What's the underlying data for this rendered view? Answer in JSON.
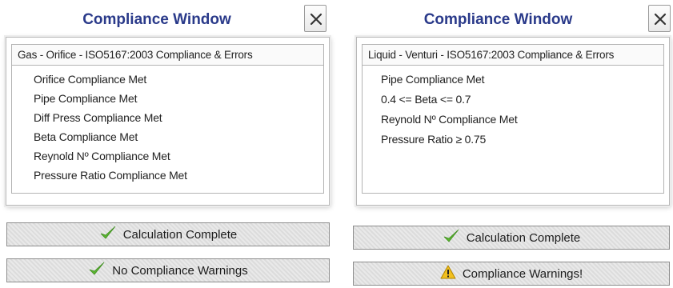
{
  "left": {
    "title": "Compliance Window",
    "header": "Gas - Orifice - ISO5167:2003 Compliance & Errors",
    "items": [
      "Orifice Compliance Met",
      "Pipe Compliance Met",
      "Diff Press Compliance Met",
      "Beta Compliance Met",
      "Reynold Nº Compliance Met",
      "Pressure Ratio Compliance Met"
    ],
    "calc_status": "Calculation Complete",
    "calc_icon": "checkmark-icon",
    "compliance_status": "No Compliance Warnings",
    "compliance_icon": "checkmark-icon"
  },
  "right": {
    "title": "Compliance Window",
    "header": "Liquid - Venturi - ISO5167:2003 Compliance & Errors",
    "items": [
      "Pipe Compliance Met",
      "0.4 <= Beta <= 0.7",
      "Reynold Nº Compliance Met",
      "Pressure Ratio ≥ 0.75"
    ],
    "calc_status": "Calculation Complete",
    "calc_icon": "checkmark-icon",
    "compliance_status": "Compliance Warnings!",
    "compliance_icon": "warning-icon"
  },
  "colors": {
    "title": "#2a3a8a",
    "check": "#5cb531",
    "warning": "#f2c01e"
  }
}
